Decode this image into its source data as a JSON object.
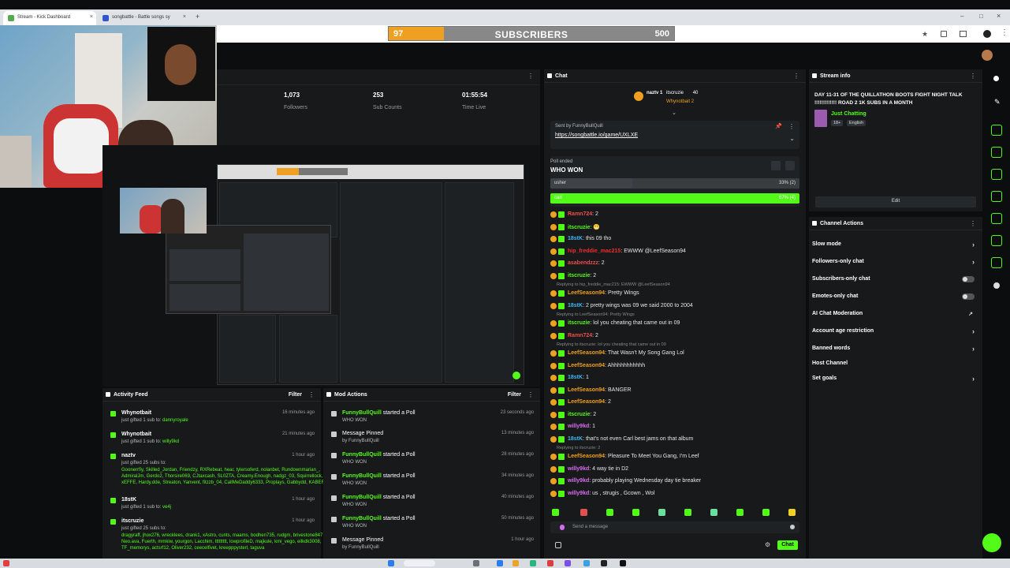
{
  "browser": {
    "tabs": [
      {
        "label": "Stream - Kick Dashboard"
      },
      {
        "label": "songbattle - Battle songs sy"
      }
    ]
  },
  "subscriber_goal": {
    "current": "97",
    "label": "SUBSCRIBERS",
    "goal": "500",
    "progress": 0.194
  },
  "stats": [
    {
      "value": "1,073",
      "label": "Followers"
    },
    {
      "value": "253",
      "label": "Sub Counts"
    },
    {
      "value": "01:55:54",
      "label": "Time Live"
    }
  ],
  "activity_feed": {
    "title": "Activity Feed",
    "filter": "Filter",
    "items": [
      {
        "name": "Whynotbait",
        "prefix": "just gifted 1 sub to:",
        "target": "dannyroyale",
        "time": "16 minutes ago"
      },
      {
        "name": "Whynotbait",
        "prefix": "just gifted 1 sub to:",
        "target": "willy9kd",
        "time": "21 minutes ago"
      },
      {
        "name": "naztv",
        "prefix": "just gifted 25 subs to:",
        "target": "Goonerrfiy, Skilled_Jordan, Friendzy, RXRebeat, hear, tylersoferd, nolanbet, Rundownmarian_, AdmiralJm, Gerdo2, Thorsire069, CJtaxcash, SL0ZTA, Creamy.Enough, nadgz_03, Squirrellock, xEFFE, Hardy.dde, Streaton, Yanvent, fitzzb_04, CallMeDaddy6333, Proplays, Gabbydd, KABER",
        "time": "1 hour ago"
      },
      {
        "name": "18stK",
        "prefix": "just gifted 1 sub to:",
        "target": "ve4j",
        "time": "1 hour ago"
      },
      {
        "name": "itscruzie",
        "prefix": "just gifted 25 subs to:",
        "target": "dragyraff, jhox276, wrecklees, drank1, xAstro, cunts, maams, bodhen735, rudgm, brivestone847, Neo.ava, Fuerth, mmkiw, yourgon, Lacchim, ttttttttt, lowprofileD, majkule, kmi_vego, eilkdk3008, TF_memorys, actsrf12, Oliver232, ceecelfivet, kreepppysterl, taguva",
        "time": "1 hour ago"
      }
    ]
  },
  "mod_actions": {
    "title": "Mod Actions",
    "filter": "Filter",
    "items": [
      {
        "user": "FunnyBullQuill",
        "action": "started a Poll",
        "sub": "WHO WON",
        "time": "23 seconds ago"
      },
      {
        "user": "",
        "action": "Message Pinned",
        "sub": "by FunnyBullQuill",
        "time": "13 minutes ago"
      },
      {
        "user": "FunnyBullQuill",
        "action": "started a Poll",
        "sub": "WHO WON",
        "time": "28 minutes ago"
      },
      {
        "user": "FunnyBullQuill",
        "action": "started a Poll",
        "sub": "WHO WON",
        "time": "34 minutes ago"
      },
      {
        "user": "FunnyBullQuill",
        "action": "started a Poll",
        "sub": "WHO WON",
        "time": "40 minutes ago"
      },
      {
        "user": "FunnyBullQuill",
        "action": "started a Poll",
        "sub": "WHO WON",
        "time": "50 minutes ago"
      },
      {
        "user": "",
        "action": "Message Pinned",
        "sub": "by FunnyBullQuill",
        "time": "1 hour ago"
      }
    ]
  },
  "chat": {
    "title": "Chat",
    "top_gifters": [
      {
        "name": "naztv",
        "count": "1"
      },
      {
        "name": "itscruzie",
        "count": "40"
      },
      {
        "name": "Whynotbait",
        "count": "2"
      }
    ],
    "pinned": {
      "by": "Sent by FunnyBullQuill",
      "link": "https://songbattle.io/game/UXLXE"
    },
    "poll": {
      "status": "Poll ended",
      "question": "WHO WON",
      "options": [
        {
          "label": "usher",
          "percent": "33% (2)",
          "share": 0.33,
          "color": "#3f4246"
        },
        {
          "label": "carl",
          "percent": "67% (4)",
          "share": 0.67,
          "color": "#53fc18"
        }
      ]
    },
    "messages": [
      {
        "reply": "",
        "user": "Ramn724",
        "color": "#ef4d4d",
        "text": ": 2"
      },
      {
        "reply": "",
        "user": "itscruzie",
        "color": "#53fc18",
        "text": ": 😬"
      },
      {
        "reply": "",
        "user": "18stK",
        "color": "#3fb8f0",
        "text": ": this 09 tho"
      },
      {
        "reply": "",
        "user": "hip_freddie_mac215",
        "color": "#ef2d2d",
        "text": ": EWWW @LeefSeason94"
      },
      {
        "reply": "",
        "user": "asabendzzz",
        "color": "#ef4d4d",
        "text": ": 2"
      },
      {
        "reply": "",
        "user": "itscruzie",
        "color": "#53fc18",
        "text": ": 2"
      },
      {
        "reply": "Replying to hip_freddie_mac215: EWWW @LeefSeason94",
        "user": "LeefSeason94",
        "color": "#f0a020",
        "text": ": Pretty Wings"
      },
      {
        "reply": "",
        "user": "18stK",
        "color": "#3fb8f0",
        "text": ": 2 pretty wings was 09 we said 2000 to 2004"
      },
      {
        "reply": "Replying to LeefSeason94: Pretty Wings",
        "user": "itscruzie",
        "color": "#53fc18",
        "text": ": lol you cheating that came out in 09"
      },
      {
        "reply": "",
        "user": "Ramn724",
        "color": "#ef4d4d",
        "text": ": 2"
      },
      {
        "reply": "Replying to itscruzie: lol you cheating that came out in 09",
        "user": "LeefSeason94",
        "color": "#f0a020",
        "text": ": That Wasn't My Song Gang Lol"
      },
      {
        "reply": "",
        "user": "LeefSeason94",
        "color": "#f0a020",
        "text": ": Ahhhhhhhhhhh"
      },
      {
        "reply": "",
        "user": "18stK",
        "color": "#3fb8f0",
        "text": ": 1"
      },
      {
        "reply": "",
        "user": "LeefSeason94",
        "color": "#f0a020",
        "text": ": BANGER"
      },
      {
        "reply": "",
        "user": "LeefSeason94",
        "color": "#f0a020",
        "text": ": 2"
      },
      {
        "reply": "",
        "user": "itscruzie",
        "color": "#53fc18",
        "text": ": 2"
      },
      {
        "reply": "",
        "user": "willy9kd",
        "color": "#d86cf0",
        "text": ": 1"
      },
      {
        "reply": "",
        "user": "18stK",
        "color": "#3fb8f0",
        "text": ": that's not even Carl best jams on that album"
      },
      {
        "reply": "Replying to itscruzie: 2",
        "user": "LeefSeason94",
        "color": "#f0a020",
        "text": ": Pleasure To Meet You Gang, I'm Leef"
      },
      {
        "reply": "",
        "user": "willy9kd",
        "color": "#d86cf0",
        "text": ": 4 way tie in D2"
      },
      {
        "reply": "",
        "user": "willy9kd",
        "color": "#d86cf0",
        "text": ": probably playing Wednesday day tie breaker"
      },
      {
        "reply": "",
        "user": "willy9kd",
        "color": "#d86cf0",
        "text": ": us , strugis , Gcown , Wol"
      }
    ],
    "input_placeholder": "Send a message",
    "send_label": "Chat"
  },
  "stream_info": {
    "title": "Stream info",
    "stream_title": "DAY 11-31 OF THE QUILLATHON BOOTS FIGHT NIGHT TALK !!!!!!!!!!!!! ROAD 2 1K SUBS IN A MONTH",
    "category": "Just Chatting",
    "tags": [
      "18+",
      "English"
    ],
    "edit_label": "Edit"
  },
  "channel_actions": {
    "title": "Channel Actions",
    "items": [
      {
        "label": "Slow mode",
        "control": "chevron"
      },
      {
        "label": "Followers-only chat",
        "control": "chevron"
      },
      {
        "label": "Subscribers-only chat",
        "control": "toggle"
      },
      {
        "label": "Emotes-only chat",
        "control": "toggle"
      },
      {
        "label": "AI Chat Moderation",
        "control": "external"
      },
      {
        "label": "Account age restriction",
        "control": "chevron"
      },
      {
        "label": "Banned words",
        "control": "chevron"
      },
      {
        "label": "Host Channel",
        "control": "none"
      },
      {
        "label": "Set goals",
        "control": "chevron"
      }
    ]
  },
  "colors": {
    "accent": "#53fc18",
    "panel": "#17191b",
    "background": "#0b0d0e",
    "sub_bar": "#f0a020"
  }
}
